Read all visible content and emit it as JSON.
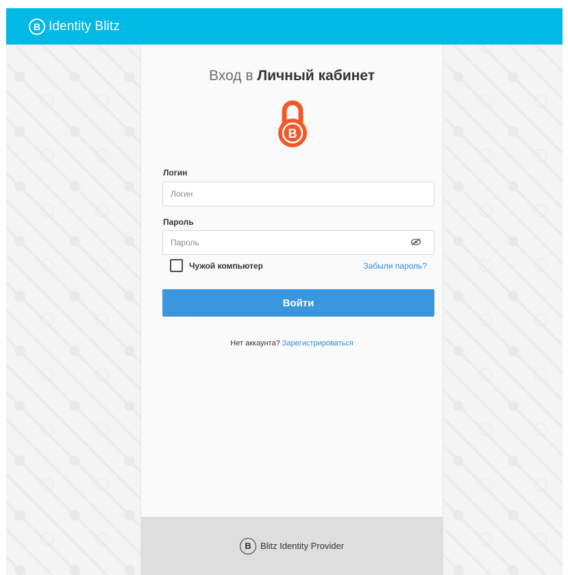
{
  "header": {
    "brand_logo_letter": "B",
    "brand_name": "Identity Blitz"
  },
  "login_card": {
    "title_light": "Вход в",
    "title_bold": "Личный кабинет",
    "lock_icon": "lock-b-icon",
    "login": {
      "label": "Логин",
      "placeholder": "Логин",
      "value": ""
    },
    "password": {
      "label": "Пароль",
      "placeholder": "Пароль",
      "value": "",
      "toggle_icon": "eye-hidden-icon"
    },
    "remember": {
      "label": "Чужой компьютер",
      "checked": false
    },
    "forgot_link": "Забыли пароль?",
    "submit_label": "Войти",
    "register_text": "Нет аккаунта?",
    "register_link": "Зарегистрироваться"
  },
  "footer": {
    "logo_letter": "B",
    "text": "Blitz Identity Provider"
  },
  "colors": {
    "topbar": "#00b9e4",
    "button": "#3a96dd",
    "link": "#2f8fd6",
    "lock": "#f05a28"
  }
}
